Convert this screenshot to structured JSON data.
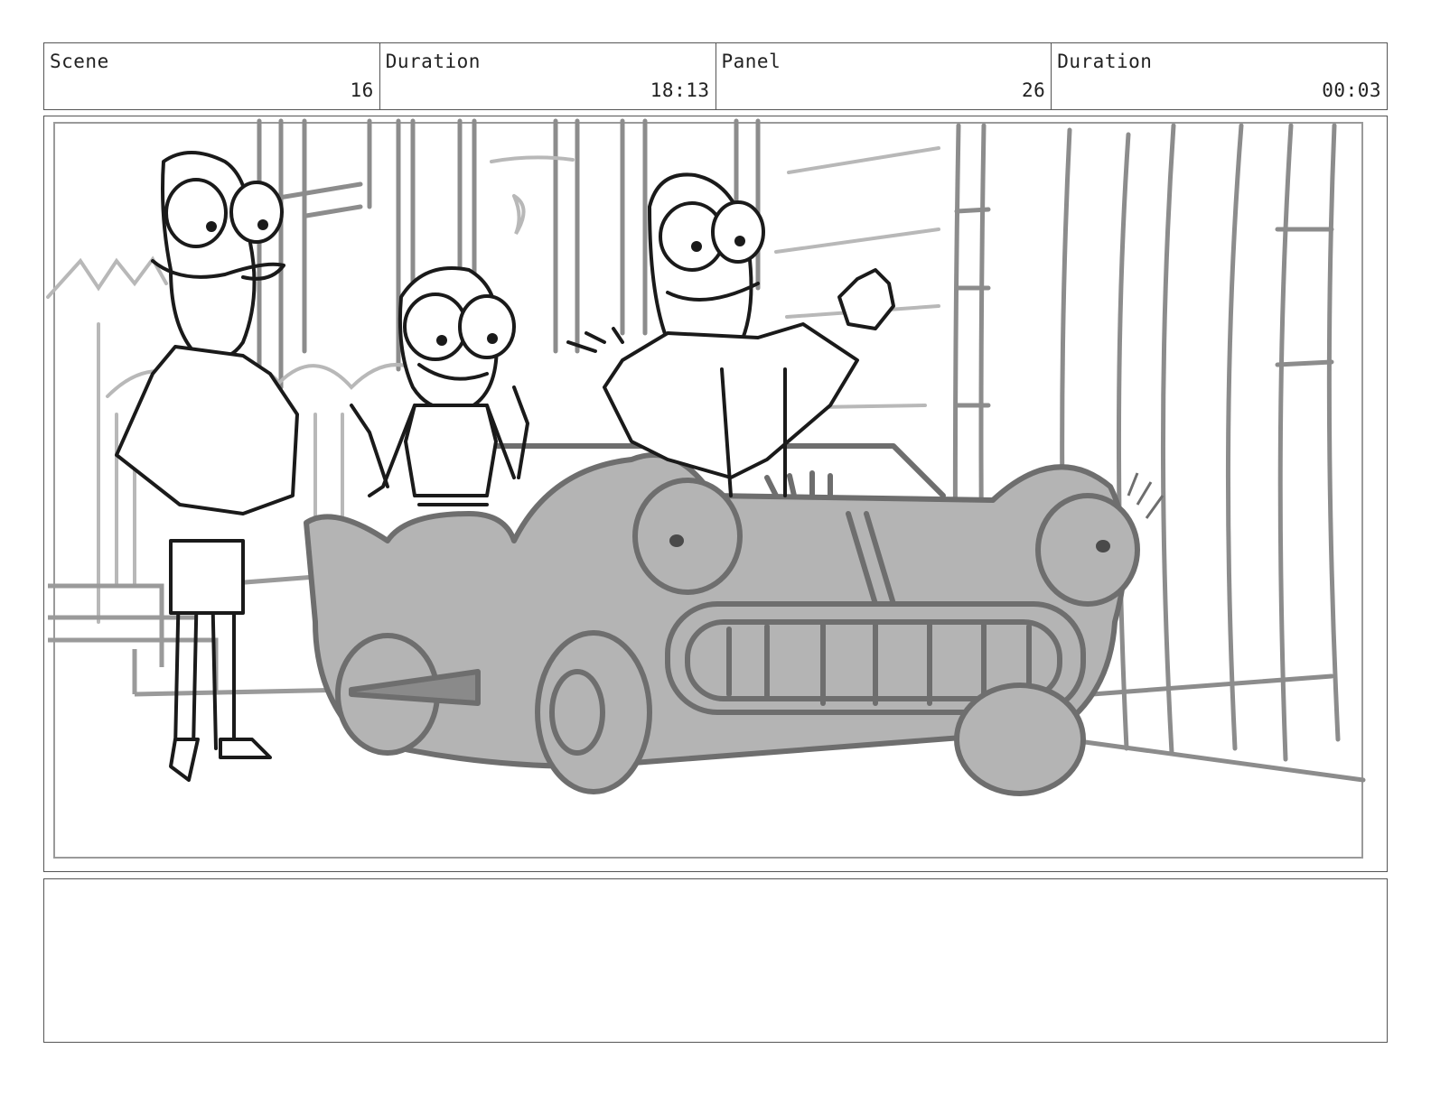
{
  "header": {
    "scene_label": "Scene",
    "scene_value": "16",
    "scene_duration_label": "Duration",
    "scene_duration_value": "18:13",
    "panel_label": "Panel",
    "panel_value": "26",
    "panel_duration_label": "Duration",
    "panel_duration_value": "00:03"
  },
  "notes": {
    "text": ""
  },
  "colors": {
    "line": "#1a1a1a",
    "background_line": "#8c8c8c",
    "car_fill": "#b4b4b4",
    "car_line": "#6e6e6e"
  }
}
